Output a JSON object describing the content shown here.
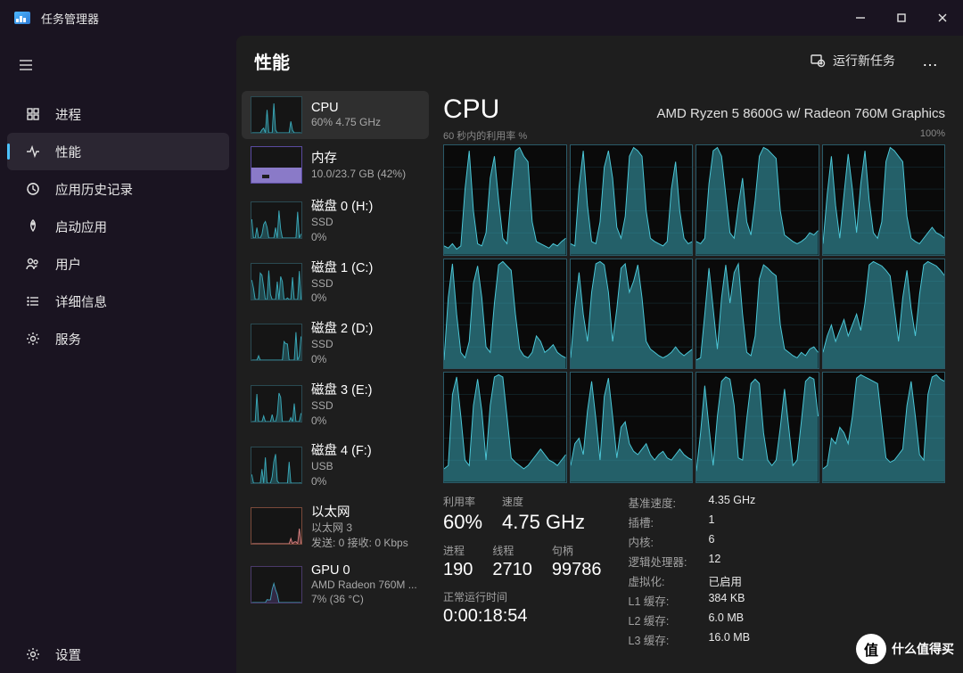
{
  "app_title": "任务管理器",
  "window_controls": {
    "min": "minimize",
    "max": "maximize",
    "close": "close"
  },
  "nav": {
    "items": [
      {
        "label": "进程",
        "icon": "grid"
      },
      {
        "label": "性能",
        "icon": "activity"
      },
      {
        "label": "应用历史记录",
        "icon": "history"
      },
      {
        "label": "启动应用",
        "icon": "startup"
      },
      {
        "label": "用户",
        "icon": "users"
      },
      {
        "label": "详细信息",
        "icon": "list"
      },
      {
        "label": "服务",
        "icon": "gear"
      }
    ],
    "settings": "设置",
    "active_index": 1
  },
  "header": {
    "title": "性能",
    "run_task": "运行新任务",
    "more": "…"
  },
  "perf_list": [
    {
      "title": "CPU",
      "sub1": "60% 4.75 GHz",
      "color": "teal",
      "active": true
    },
    {
      "title": "内存",
      "sub1": "10.0/23.7 GB (42%)",
      "color": "mem"
    },
    {
      "title": "磁盘 0 (H:)",
      "sub1": "SSD",
      "sub2": "0%",
      "color": "teal"
    },
    {
      "title": "磁盘 1 (C:)",
      "sub1": "SSD",
      "sub2": "0%",
      "color": "teal"
    },
    {
      "title": "磁盘 2 (D:)",
      "sub1": "SSD",
      "sub2": "0%",
      "color": "teal"
    },
    {
      "title": "磁盘 3 (E:)",
      "sub1": "SSD",
      "sub2": "0%",
      "color": "teal"
    },
    {
      "title": "磁盘 4 (F:)",
      "sub1": "USB",
      "sub2": "0%",
      "color": "teal"
    },
    {
      "title": "以太网",
      "sub1": "以太网 3",
      "sub2": "发送: 0 接收: 0 Kbps",
      "color": "net"
    },
    {
      "title": "GPU 0",
      "sub1": "AMD Radeon 760M ...",
      "sub2": "7% (36 °C)",
      "color": "gpu"
    }
  ],
  "detail": {
    "title": "CPU",
    "cpu_name": "AMD Ryzen 5 8600G w/ Radeon 760M Graphics",
    "axis_left": "60 秒内的利用率 %",
    "axis_right": "100%",
    "core_count": 12,
    "stats_left": {
      "util_label": "利用率",
      "util_value": "60%",
      "speed_label": "速度",
      "speed_value": "4.75 GHz",
      "proc_label": "进程",
      "proc_value": "190",
      "thread_label": "线程",
      "thread_value": "2710",
      "handle_label": "句柄",
      "handle_value": "99786",
      "uptime_label": "正常运行时间",
      "uptime_value": "0:00:18:54"
    },
    "stats_right": [
      {
        "k": "基准速度:",
        "v": "4.35 GHz"
      },
      {
        "k": "插槽:",
        "v": "1"
      },
      {
        "k": "内核:",
        "v": "6"
      },
      {
        "k": "逻辑处理器:",
        "v": "12"
      },
      {
        "k": "虚拟化:",
        "v": "已启用"
      },
      {
        "k": "L1 缓存:",
        "v": "384 KB"
      },
      {
        "k": "L2 缓存:",
        "v": "6.0 MB"
      },
      {
        "k": "L3 缓存:",
        "v": "16.0 MB"
      }
    ]
  },
  "chart_data": {
    "type": "area",
    "title": "Per-logical-processor utilization over 60s",
    "ylim": [
      0,
      100
    ],
    "xrange_seconds": 60,
    "series": [
      {
        "name": "core0",
        "values": [
          8,
          6,
          10,
          5,
          8,
          60,
          95,
          40,
          10,
          8,
          20,
          70,
          90,
          50,
          15,
          10,
          55,
          95,
          98,
          90,
          85,
          30,
          12,
          10,
          8,
          6,
          10,
          8,
          12,
          15
        ]
      },
      {
        "name": "core1",
        "values": [
          10,
          8,
          62,
          95,
          45,
          12,
          10,
          30,
          80,
          95,
          70,
          25,
          15,
          35,
          90,
          98,
          95,
          90,
          40,
          15,
          12,
          10,
          8,
          12,
          60,
          85,
          40,
          15,
          10,
          12
        ]
      },
      {
        "name": "core2",
        "values": [
          12,
          10,
          15,
          65,
          95,
          98,
          90,
          55,
          20,
          15,
          45,
          70,
          30,
          18,
          50,
          90,
          98,
          96,
          92,
          88,
          40,
          18,
          15,
          12,
          10,
          12,
          15,
          20,
          18,
          22
        ]
      },
      {
        "name": "core3",
        "values": [
          10,
          55,
          90,
          45,
          15,
          55,
          92,
          60,
          20,
          65,
          95,
          50,
          20,
          15,
          30,
          85,
          98,
          95,
          90,
          85,
          35,
          15,
          12,
          10,
          15,
          20,
          25,
          20,
          18,
          15
        ]
      },
      {
        "name": "core4",
        "values": [
          8,
          65,
          96,
          50,
          15,
          10,
          25,
          78,
          94,
          65,
          20,
          15,
          60,
          95,
          98,
          94,
          90,
          50,
          18,
          12,
          10,
          15,
          30,
          25,
          15,
          18,
          22,
          15,
          12,
          10
        ]
      },
      {
        "name": "core5",
        "values": [
          10,
          55,
          88,
          50,
          25,
          70,
          96,
          98,
          95,
          70,
          25,
          55,
          92,
          96,
          70,
          80,
          95,
          65,
          25,
          18,
          15,
          12,
          10,
          12,
          15,
          20,
          15,
          12,
          15,
          18
        ]
      },
      {
        "name": "core6",
        "values": [
          8,
          10,
          50,
          92,
          55,
          18,
          65,
          95,
          60,
          88,
          96,
          50,
          15,
          12,
          30,
          82,
          95,
          92,
          88,
          85,
          40,
          18,
          15,
          12,
          10,
          15,
          12,
          18,
          20,
          15
        ]
      },
      {
        "name": "core7",
        "values": [
          15,
          30,
          40,
          25,
          35,
          45,
          30,
          40,
          50,
          35,
          60,
          95,
          98,
          96,
          94,
          90,
          85,
          55,
          25,
          65,
          90,
          55,
          30,
          68,
          95,
          98,
          96,
          94,
          90,
          85
        ]
      },
      {
        "name": "core8",
        "values": [
          12,
          15,
          80,
          96,
          60,
          20,
          15,
          70,
          94,
          65,
          20,
          70,
          96,
          98,
          96,
          60,
          22,
          18,
          15,
          12,
          15,
          20,
          25,
          30,
          25,
          20,
          18,
          15,
          20,
          25
        ]
      },
      {
        "name": "core9",
        "values": [
          15,
          35,
          40,
          25,
          65,
          92,
          58,
          20,
          78,
          95,
          60,
          22,
          50,
          55,
          35,
          28,
          25,
          30,
          35,
          25,
          20,
          25,
          28,
          22,
          20,
          25,
          30,
          25,
          22,
          20
        ]
      },
      {
        "name": "core10",
        "values": [
          10,
          45,
          88,
          50,
          15,
          60,
          92,
          96,
          94,
          70,
          22,
          20,
          58,
          90,
          94,
          90,
          45,
          20,
          15,
          20,
          50,
          85,
          50,
          15,
          20,
          55,
          92,
          96,
          94,
          60
        ]
      },
      {
        "name": "core11",
        "values": [
          12,
          15,
          40,
          35,
          50,
          45,
          35,
          60,
          95,
          98,
          96,
          94,
          92,
          90,
          55,
          22,
          18,
          20,
          25,
          30,
          70,
          92,
          60,
          25,
          20,
          80,
          96,
          98,
          94,
          92
        ]
      }
    ]
  },
  "watermark": {
    "badge": "值",
    "text": "什么值得买"
  }
}
